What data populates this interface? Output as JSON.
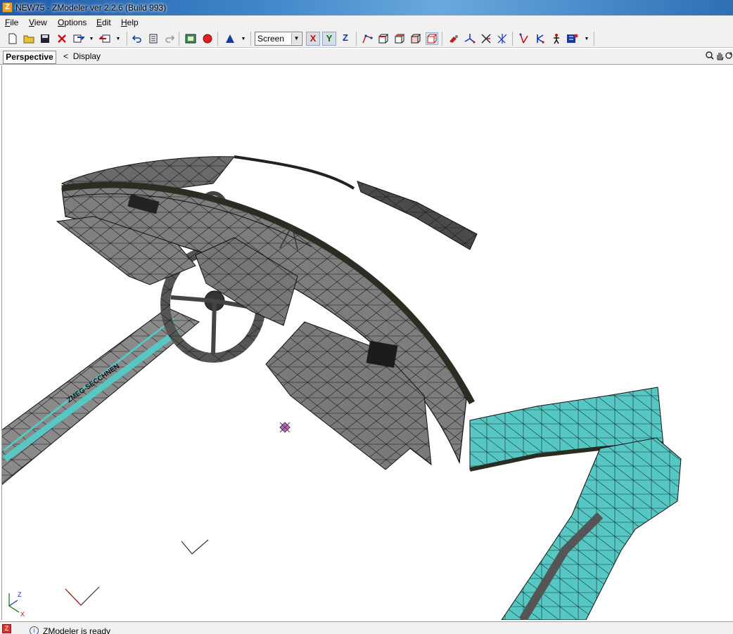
{
  "window": {
    "title": "NEW75 - ZModeler ver 2.2.6 (Build 993)"
  },
  "menu": [
    {
      "accel": "F",
      "rest": "ile"
    },
    {
      "accel": "V",
      "rest": "iew"
    },
    {
      "accel": "O",
      "rest": "ptions"
    },
    {
      "accel": "E",
      "rest": "dit"
    },
    {
      "accel": "H",
      "rest": "elp"
    }
  ],
  "toolbar": {
    "mode_select": "Screen",
    "axes": {
      "x": "X",
      "y": "Y",
      "z": "Z"
    }
  },
  "viewport": {
    "tab": "Perspective",
    "back": "<",
    "display": "Display"
  },
  "model_text": "ZMEG-SECCHNEN",
  "gizmo": {
    "z": "Z",
    "x": "X"
  },
  "status": {
    "text": "ZModeler is ready"
  },
  "colors": {
    "accent_mesh": "#56c7c3",
    "mesh_gray": "#7d7d7d"
  }
}
